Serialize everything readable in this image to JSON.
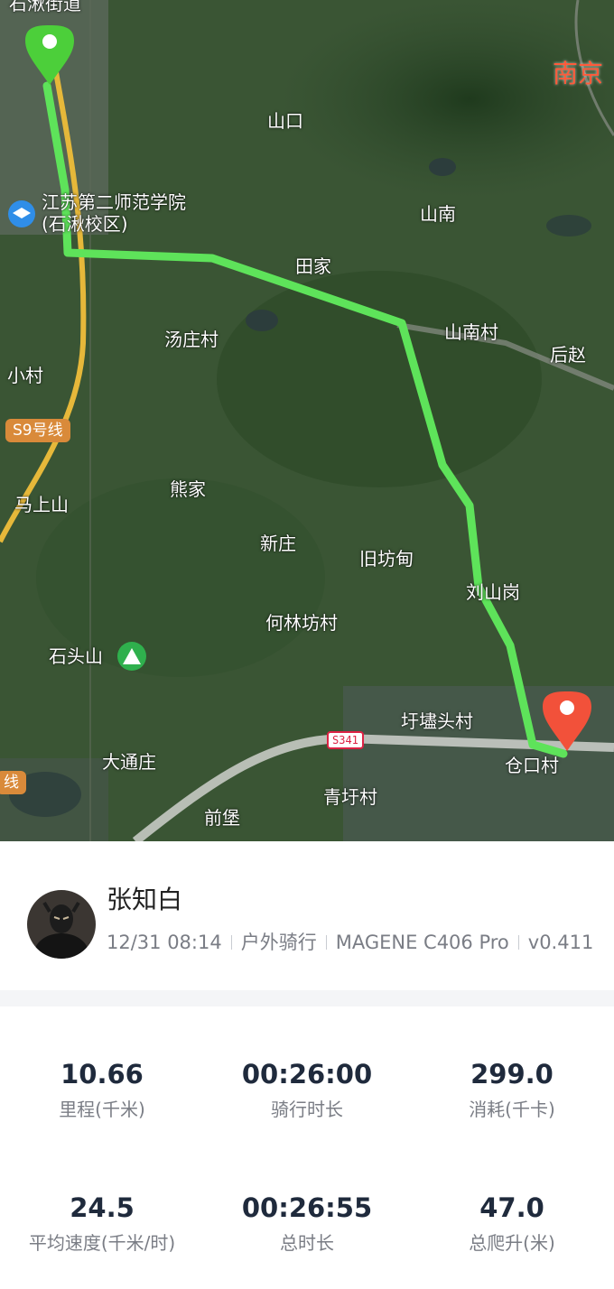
{
  "map": {
    "labels": {
      "top_road": "石湫街道",
      "nanjing": "南京",
      "shankou": "山口",
      "school": "江苏第二师范学院(石湫校区)",
      "shannan": "山南",
      "tianjia": "田家",
      "tangzhuang": "汤庄村",
      "shannancun": "山南村",
      "houzhao": "后赵",
      "xiaocun": "小村",
      "xiongjia": "熊家",
      "mashangshan": "马上山",
      "xinzhuang": "新庄",
      "jiufangdian": "旧坊甸",
      "liushangang": "刘山岗",
      "helinfang": "何林坊村",
      "shitoushan": "石头山",
      "yujitoucun": "圩壗头村",
      "datongzhuang": "大通庄",
      "cangkoucun": "仓口村",
      "qingyucun": "青圩村",
      "qianbao": "前堡"
    },
    "highway_label": "S9号线",
    "line_label": "线",
    "road_shield": "S341",
    "route_color": "#5ee35a",
    "start_marker_color": "#4ccf3a",
    "end_marker_color": "#f2513a"
  },
  "user": {
    "name": "张知白",
    "datetime": "12/31 08:14",
    "activity": "户外骑行",
    "device": "MAGENE C406 Pro",
    "version": "v0.411"
  },
  "stats": [
    {
      "value": "10.66",
      "label": "里程(千米)"
    },
    {
      "value": "00:26:00",
      "label": "骑行时长"
    },
    {
      "value": "299.0",
      "label": "消耗(千卡)"
    },
    {
      "value": "24.5",
      "label": "平均速度(千米/时)"
    },
    {
      "value": "00:26:55",
      "label": "总时长"
    },
    {
      "value": "47.0",
      "label": "总爬升(米)"
    }
  ]
}
